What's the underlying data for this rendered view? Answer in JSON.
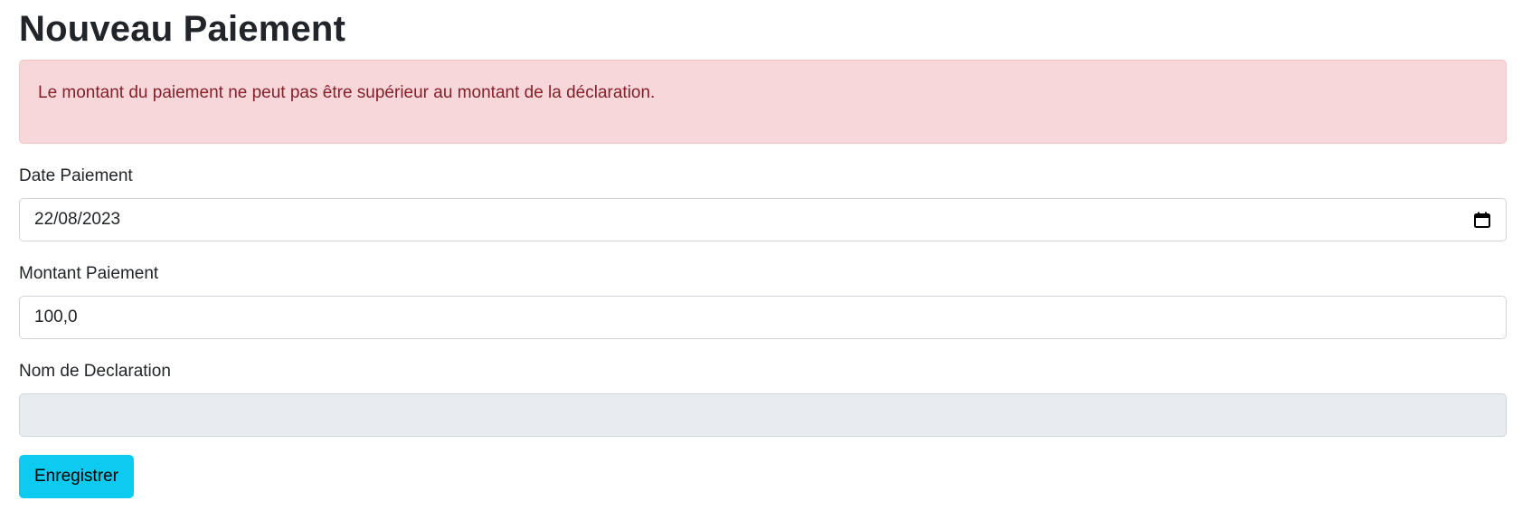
{
  "page": {
    "title": "Nouveau Paiement"
  },
  "alert": {
    "message": "Le montant du paiement ne peut pas être supérieur au montant de la déclaration.",
    "bg_color": "#f8d7da",
    "text_color": "#842029"
  },
  "form": {
    "date_label": "Date Paiement",
    "date_value": "22/08/2023",
    "amount_label": "Montant Paiement",
    "amount_value": "100,0",
    "declaration_label": "Nom de Declaration",
    "declaration_value": "",
    "submit_label": "Enregistrer",
    "submit_color": "#0dcaf0",
    "date_icon": "calendar-icon"
  }
}
